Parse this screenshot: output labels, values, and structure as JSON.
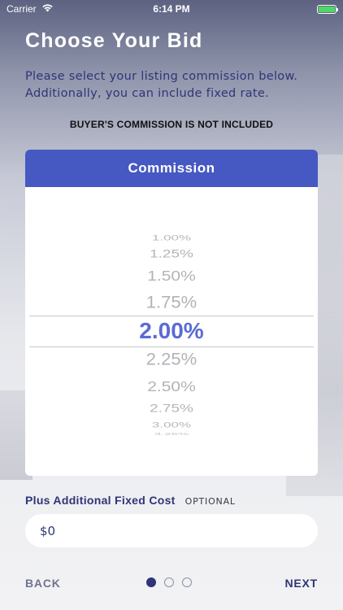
{
  "status_bar": {
    "carrier": "Carrier",
    "time": "6:14 PM",
    "wifi_icon": "wifi-icon",
    "battery_icon": "battery-icon",
    "battery_level": 1.0,
    "battery_color": "#4cd964"
  },
  "header": {
    "title": "Choose Your Bid",
    "subtitle": "Please select your listing commission below. Additionally, you can include fixed rate.",
    "notice": "BUYER'S COMMISSION IS NOT INCLUDED"
  },
  "commission_card": {
    "header_label": "Commission",
    "header_color": "#4658c2",
    "options": [
      "1.00%",
      "1.25%",
      "1.50%",
      "1.75%",
      "2.00%",
      "2.25%",
      "2.50%",
      "2.75%",
      "3.00%",
      "3.25%"
    ],
    "selected_value": "2.00%",
    "selected_color": "#5a6bd6"
  },
  "fixed_cost": {
    "label": "Plus Additional Fixed Cost",
    "optional_label": "OPTIONAL",
    "value": "$0"
  },
  "navigation": {
    "back_label": "BACK",
    "next_label": "NEXT",
    "page_count": 3,
    "current_page": 1
  }
}
